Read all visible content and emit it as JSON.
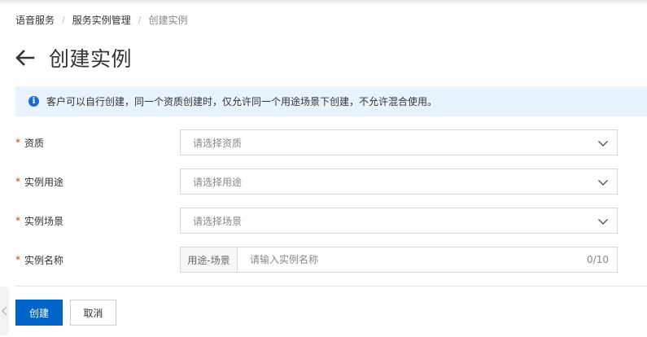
{
  "breadcrumb": {
    "items": [
      "语音服务",
      "服务实例管理",
      "创建实例"
    ],
    "separator": "/"
  },
  "header": {
    "back_icon": "arrow-left-icon",
    "title": "创建实例"
  },
  "alert": {
    "icon": "info-icon",
    "icon_glyph": "i",
    "text": "客户可以自行创建，同一个资质创建时，仅允许同一个用途场景下创建，不允许混合使用。"
  },
  "form": {
    "required_mark": "*",
    "qualification": {
      "label": "资质",
      "placeholder": "请选择资质"
    },
    "purpose": {
      "label": "实例用途",
      "placeholder": "请选择用途"
    },
    "scene": {
      "label": "实例场景",
      "placeholder": "请选择场景"
    },
    "name": {
      "label": "实例名称",
      "addon": "用途-场景",
      "placeholder": "请输入实例名称",
      "value": "",
      "counter": "0/10"
    }
  },
  "actions": {
    "create_label": "创建",
    "cancel_label": "取消"
  },
  "colors": {
    "primary": "#0064c8",
    "alert_bg": "#e8f3fe",
    "info_icon": "#1b6fc9",
    "required": "#d93026"
  }
}
